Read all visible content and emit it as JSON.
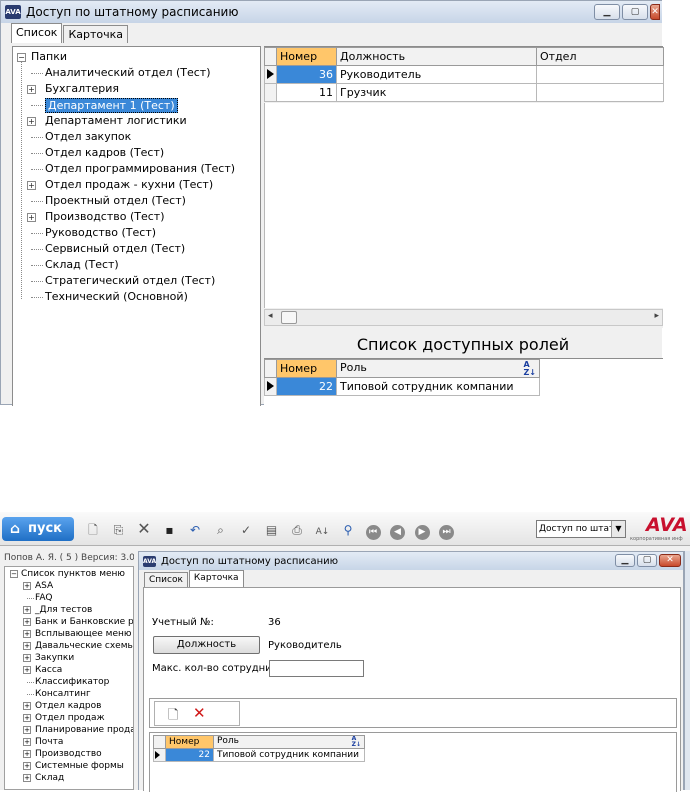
{
  "top_window": {
    "title": "Доступ по штатному расписанию",
    "tabs": [
      "Список",
      "Карточка"
    ],
    "tree": {
      "root": "Папки",
      "items": [
        {
          "label": "Аналитический отдел (Тест)",
          "expandable": false
        },
        {
          "label": "Бухгалтерия",
          "expandable": true
        },
        {
          "label": "Департамент 1 (Тест)",
          "expandable": false,
          "selected": true
        },
        {
          "label": "Департамент логистики",
          "expandable": true
        },
        {
          "label": "Отдел закупок",
          "expandable": false
        },
        {
          "label": "Отдел кадров (Тест)",
          "expandable": false
        },
        {
          "label": "Отдел программирования (Тест)",
          "expandable": false
        },
        {
          "label": "Отдел продаж - кухни (Тест)",
          "expandable": true
        },
        {
          "label": "Проектный отдел (Тест)",
          "expandable": false
        },
        {
          "label": "Производство (Тест)",
          "expandable": true
        },
        {
          "label": "Руководство (Тест)",
          "expandable": false
        },
        {
          "label": "Сервисный отдел (Тест)",
          "expandable": false
        },
        {
          "label": "Склад (Тест)",
          "expandable": false
        },
        {
          "label": "Стратегический отдел (Тест)",
          "expandable": false
        },
        {
          "label": "Технический (Основной)",
          "expandable": false
        }
      ]
    },
    "positions_grid": {
      "columns": [
        "Номер",
        "Должность",
        "Отдел"
      ],
      "rows": [
        {
          "num": "36",
          "position": "Руководитель",
          "dept": ""
        },
        {
          "num": "11",
          "position": "Грузчик",
          "dept": ""
        }
      ]
    },
    "roles_title": "Список доступных ролей",
    "roles_grid": {
      "columns": [
        "Номер",
        "Роль"
      ],
      "rows": [
        {
          "num": "22",
          "role": "Типовой сотрудник компании"
        }
      ]
    }
  },
  "app": {
    "start_label": "пуск",
    "combo_value": "Доступ по штатном",
    "logo": "AVA",
    "logo_sub": "корпоративная инф",
    "user_info": "Попов А. Я. ( 5 )  Версия: 3.0",
    "menu_tree": {
      "root": "Список пунктов меню",
      "items": [
        {
          "label": "ASA",
          "expandable": true
        },
        {
          "label": "FAQ",
          "expandable": false
        },
        {
          "label": "_Для тестов",
          "expandable": true
        },
        {
          "label": "Банк и Банковские ре",
          "expandable": true
        },
        {
          "label": "Всплывающее меню",
          "expandable": true
        },
        {
          "label": "Давальческие схемы",
          "expandable": true
        },
        {
          "label": "Закупки",
          "expandable": true
        },
        {
          "label": "Касса",
          "expandable": true
        },
        {
          "label": "Классификатор",
          "expandable": false
        },
        {
          "label": "Консалтинг",
          "expandable": false
        },
        {
          "label": "Отдел кадров",
          "expandable": true
        },
        {
          "label": "Отдел продаж",
          "expandable": true
        },
        {
          "label": "Планирование продаж",
          "expandable": true
        },
        {
          "label": "Почта",
          "expandable": true
        },
        {
          "label": "Производство",
          "expandable": true
        },
        {
          "label": "Системные формы",
          "expandable": true
        },
        {
          "label": "Склад",
          "expandable": true
        }
      ]
    },
    "card_window": {
      "title": "Доступ по штатному расписанию",
      "tabs": [
        "Список",
        "Карточка"
      ],
      "account_label": "Учетный №:",
      "account_value": "36",
      "position_button": "Должность",
      "position_value": "Руководитель",
      "max_label": "Макс. кол-во сотрудников:",
      "max_value": "",
      "roles_grid": {
        "columns": [
          "Номер",
          "Роль"
        ],
        "rows": [
          {
            "num": "22",
            "role": "Типовой сотрудник компании"
          }
        ]
      }
    }
  },
  "colors": {
    "selection": "#3a88d8",
    "sorted_header": "#ffc66a",
    "start_button": "#1f6fc5",
    "logo": "#c8102e"
  }
}
